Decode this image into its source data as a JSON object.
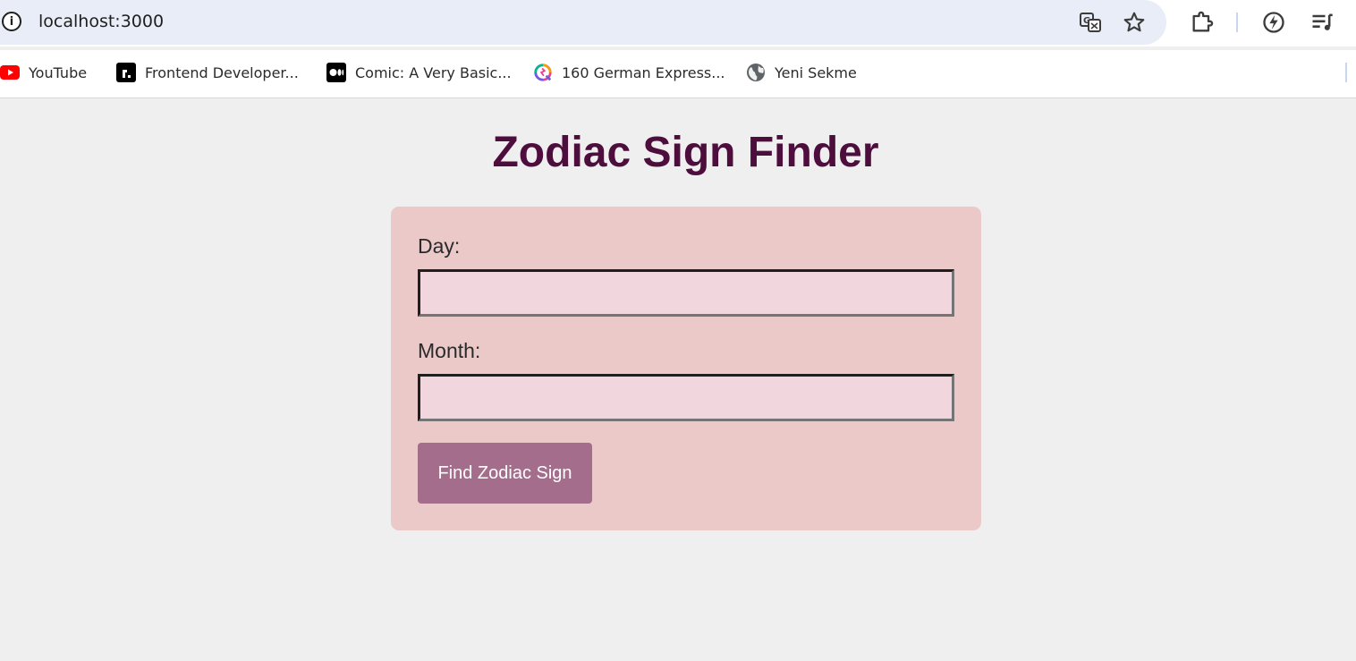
{
  "browser": {
    "url": "localhost:3000",
    "bookmarks": [
      {
        "label": "YouTube",
        "icon": "youtube-icon"
      },
      {
        "label": "Frontend Developer...",
        "icon": "roadmap-icon"
      },
      {
        "label": "Comic: A Very Basic...",
        "icon": "medium-icon"
      },
      {
        "label": "160 German Express...",
        "icon": "colorful-q-icon"
      },
      {
        "label": "Yeni Sekme",
        "icon": "globe-icon"
      }
    ],
    "toolbar_icons": [
      "translate-icon",
      "star-icon",
      "extensions-icon",
      "leaf-icon",
      "playlist-icon"
    ]
  },
  "page": {
    "title": "Zodiac Sign Finder",
    "day_label": "Day:",
    "day_value": "",
    "month_label": "Month:",
    "month_value": "",
    "button_label": "Find Zodiac Sign"
  },
  "colors": {
    "title": "#4d0d3d",
    "card": "#ebc9c9",
    "input_bg": "#f1d6de",
    "button": "#a56d8c",
    "page_bg": "#efefef"
  }
}
